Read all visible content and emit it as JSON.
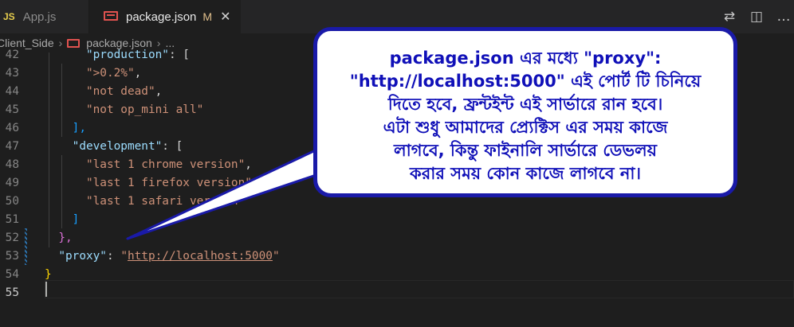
{
  "tabs": [
    {
      "badge": "JS",
      "label": "App.js"
    },
    {
      "label": "package.json",
      "modified": "M",
      "close": "✕"
    }
  ],
  "actions": [
    {
      "icon": "source-control-compare-icon",
      "glyph": "⇄"
    },
    {
      "icon": "split-editor-icon",
      "glyph": "◫"
    },
    {
      "icon": "more-actions-icon",
      "glyph": "…"
    }
  ],
  "breadcrumb": {
    "folder": "Client_Side",
    "file": "package.json",
    "more": "..."
  },
  "lines": [
    {
      "n": "42"
    },
    {
      "n": "43"
    },
    {
      "n": "44"
    },
    {
      "n": "45"
    },
    {
      "n": "46"
    },
    {
      "n": "47"
    },
    {
      "n": "48"
    },
    {
      "n": "49"
    },
    {
      "n": "50"
    },
    {
      "n": "51"
    },
    {
      "n": "52"
    },
    {
      "n": "53"
    },
    {
      "n": "54"
    },
    {
      "n": "55"
    }
  ],
  "code": {
    "l42_key": "\"production\"",
    "l42_rest": ": [",
    "l43": "\">0.2%\"",
    "l44": "\"not dead\"",
    "l45": "\"not op_mini all\"",
    "l46": "],",
    "l47_key": "\"development\"",
    "l47_rest": ": [",
    "l48": "\"last 1 chrome version\"",
    "l49": "\"last 1 firefox version\"",
    "l50": "\"last 1 safari version\"",
    "l51": "]",
    "l52": "},",
    "l53_key": "\"proxy\"",
    "l53_colon": ": ",
    "l53_q1": "\"",
    "l53_url": "http://localhost:5000",
    "l53_q2": "\"",
    "l54": "}"
  },
  "callout": {
    "lines": [
      "package.json এর মধ্যে \"proxy\":",
      "\"http://localhost:5000\" এই পোর্ট টি চিনিয়ে",
      "দিতে হবে, ফ্রন্টইন্ট এই সার্ভারে রান হবে।",
      "এটা শুধু আমাদের প্র্যেক্টিস এর সময় কাজে",
      "লাগবে, কিন্তু ফাইনালি সার্ভারে ডেভলয়",
      "করার সময় কোন কাজে লাগবে না।"
    ]
  },
  "colors": {
    "callout_border": "#1a1aa8",
    "callout_text": "#1010b8",
    "editor_bg": "#1e1e1e"
  }
}
